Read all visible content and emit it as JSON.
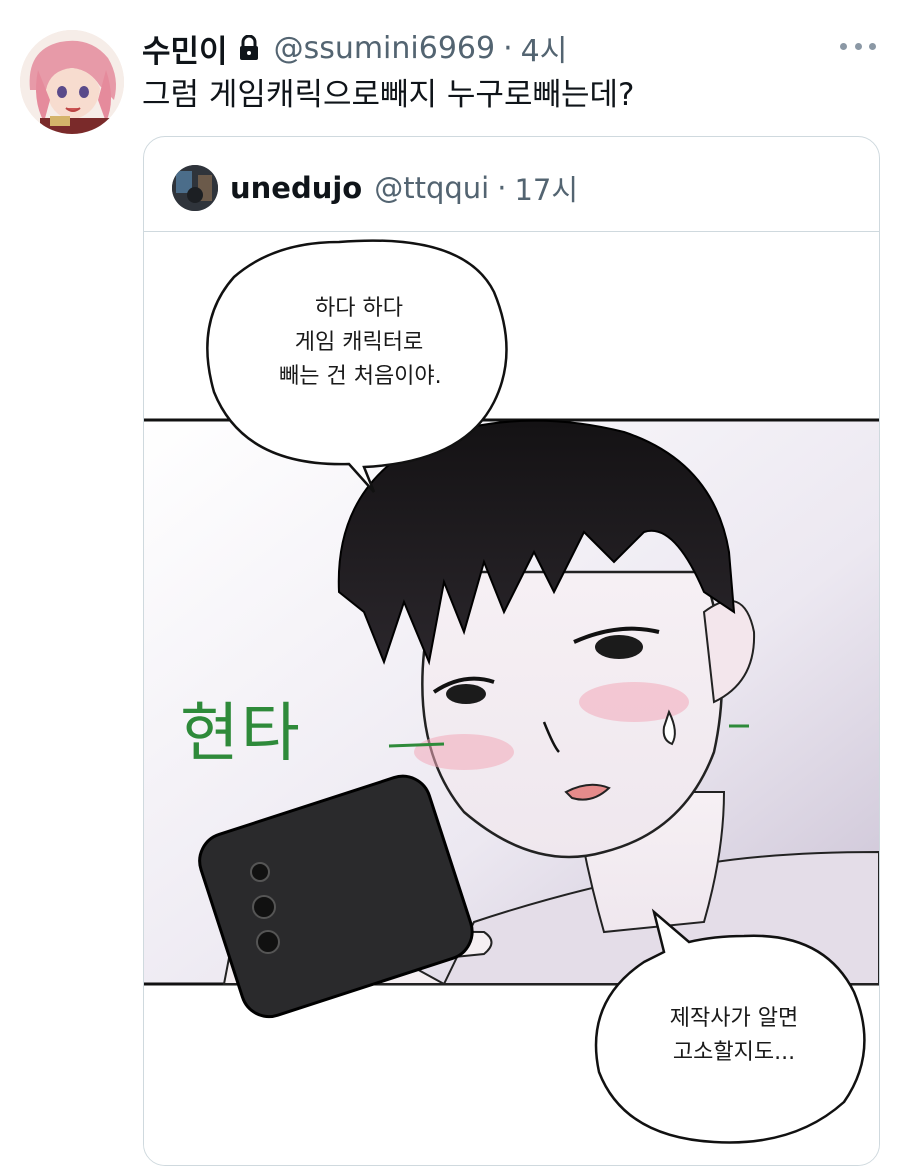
{
  "tweet": {
    "display_name": "수민이",
    "handle": "@ssumini6969",
    "separator": "·",
    "time": "4시",
    "text": "그럼 게임캐릭으로빼지 누구로빼는데?",
    "icons": [
      "lock-icon",
      "more-icon"
    ]
  },
  "quote": {
    "display_name": "unedujo",
    "handle": "@ttqqui",
    "separator": "·",
    "time": "17시",
    "comic": {
      "bubble_top_lines": [
        "하다 하다",
        "게임 캐릭터로",
        "빼는 건 처음이야."
      ],
      "sfx": "현타",
      "bubble_bottom_lines": [
        "제작사가 알면",
        "고소할지도..."
      ]
    }
  },
  "colors": {
    "text_primary": "#0f1419",
    "text_secondary": "#536471",
    "border": "#cfd9de",
    "sfx_green": "#2e8a3a"
  }
}
